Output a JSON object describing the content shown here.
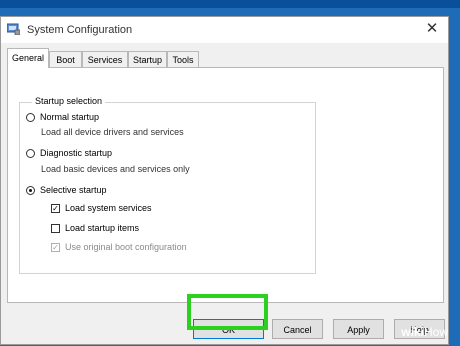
{
  "window": {
    "title": "System Configuration",
    "close_glyph": "✕"
  },
  "tabs": [
    "General",
    "Boot",
    "Services",
    "Startup",
    "Tools"
  ],
  "group": {
    "title": "Startup selection"
  },
  "options": {
    "normal": {
      "label": "Normal startup",
      "description": "Load all device drivers and services",
      "selected": false
    },
    "diagnostic": {
      "label": "Diagnostic startup",
      "description": "Load basic devices and services only",
      "selected": false
    },
    "selective": {
      "label": "Selective startup",
      "selected": true
    }
  },
  "checks": {
    "load_system_services": {
      "label": "Load system services",
      "checked": true
    },
    "load_startup_items": {
      "label": "Load startup items",
      "checked": false
    },
    "use_original_boot": {
      "label": "Use original boot configuration",
      "checked": true,
      "disabled": true
    }
  },
  "buttons": {
    "ok": "OK",
    "cancel": "Cancel",
    "apply": "Apply",
    "help": "Help"
  },
  "watermark": {
    "wiki": "wiki",
    "how": "How"
  },
  "colors": {
    "desktop": "#1e6bb8",
    "highlight": "#2bd021"
  }
}
